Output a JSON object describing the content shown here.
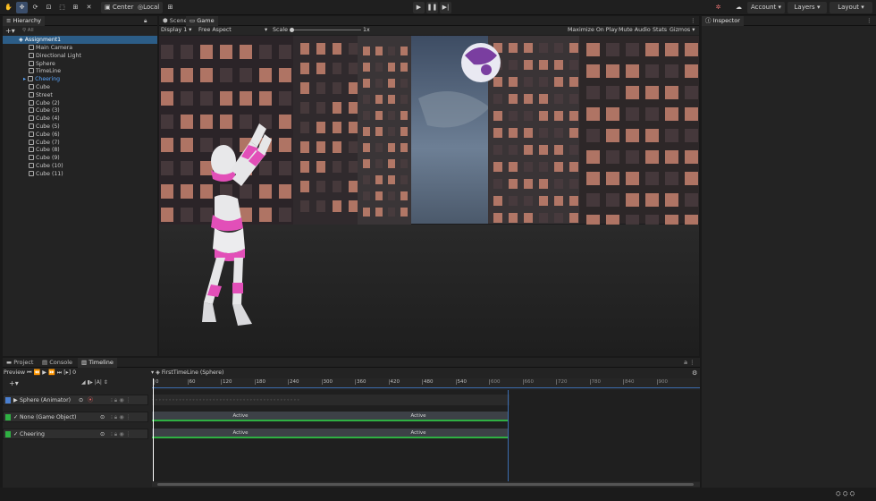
{
  "toolbar": {
    "center_label": "Center",
    "local_label": "Local",
    "account_label": "Account",
    "layers_label": "Layers",
    "layout_label": "Layout"
  },
  "hierarchy": {
    "tab_label": "Hierarchy",
    "search_placeholder": "All",
    "root": "Assignment1",
    "items": [
      {
        "label": "Main Camera"
      },
      {
        "label": "Directional Light"
      },
      {
        "label": "Sphere"
      },
      {
        "label": "TimeLine"
      },
      {
        "label": "Cheering"
      },
      {
        "label": "Cube"
      },
      {
        "label": "Street"
      },
      {
        "label": "Cube (2)"
      },
      {
        "label": "Cube (3)"
      },
      {
        "label": "Cube (4)"
      },
      {
        "label": "Cube (5)"
      },
      {
        "label": "Cube (6)"
      },
      {
        "label": "Cube (7)"
      },
      {
        "label": "Cube (8)"
      },
      {
        "label": "Cube (9)"
      },
      {
        "label": "Cube (10)"
      },
      {
        "label": "Cube (11)"
      }
    ]
  },
  "game": {
    "tabs": [
      "Scene",
      "Game"
    ],
    "display": "Display 1",
    "aspect": "Free Aspect",
    "scale_label": "Scale",
    "scale_value": "1x",
    "right_options": [
      "Maximize On Play",
      "Mute Audio",
      "Stats",
      "Gizmos"
    ]
  },
  "inspector": {
    "tab_label": "Inspector"
  },
  "bottom": {
    "tabs": [
      "Project",
      "Console",
      "Timeline"
    ],
    "preview_label": "Preview",
    "frame": "0",
    "asset_name": "FirstTimeLine (Sphere)",
    "ruler_ticks": [
      "0",
      "60",
      "120",
      "180",
      "240",
      "300",
      "360",
      "420",
      "480",
      "540",
      "600",
      "660",
      "720",
      "780",
      "840",
      "900"
    ],
    "tracks": [
      {
        "name": "Sphere (Animator)"
      },
      {
        "name": "None (Game Object)"
      },
      {
        "name": "Cheering"
      }
    ],
    "clips": [
      {
        "label": "Active"
      },
      {
        "label": "Active"
      },
      {
        "label": "Active"
      },
      {
        "label": "Active"
      }
    ]
  },
  "colors": {
    "accent": "#2c5d87",
    "clip_active": "#2fb043",
    "playhead": "#ffffff"
  }
}
